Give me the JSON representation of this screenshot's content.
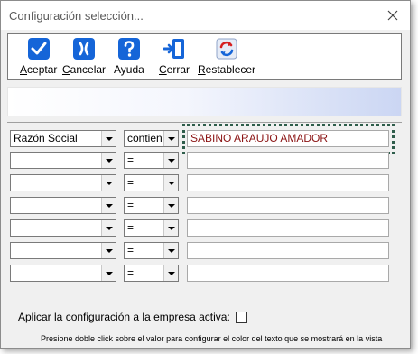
{
  "window": {
    "title": "Configuración selección..."
  },
  "toolbar": {
    "buttons": [
      {
        "label": "Aceptar",
        "mnemonic": "A",
        "rest": "ceptar",
        "icon": "checkmark-icon"
      },
      {
        "label": "Cancelar",
        "mnemonic": "C",
        "rest": "ancelar",
        "icon": "x-cancel-icon"
      },
      {
        "label": "Ayuda",
        "mnemonic": "",
        "rest": "Ayuda",
        "icon": "question-icon"
      },
      {
        "label": "Cerrar",
        "mnemonic": "C",
        "rest": "errar",
        "icon": "exit-door-icon"
      },
      {
        "label": "Restablecer",
        "mnemonic": "R",
        "rest": "establecer",
        "icon": "refresh-icon"
      }
    ]
  },
  "filters": [
    {
      "field": "Razón Social",
      "operator": "contiene",
      "value": "SABINO ARAUJO AMADOR"
    },
    {
      "field": "",
      "operator": "=",
      "value": ""
    },
    {
      "field": "",
      "operator": "=",
      "value": ""
    },
    {
      "field": "",
      "operator": "=",
      "value": ""
    },
    {
      "field": "",
      "operator": "=",
      "value": ""
    },
    {
      "field": "",
      "operator": "=",
      "value": ""
    },
    {
      "field": "",
      "operator": "=",
      "value": ""
    }
  ],
  "apply_label": "Aplicar la configuración a la empresa activa:",
  "apply_checked": false,
  "hint": "Presione doble click sobre el valor para configurar el color del texto que se mostrará en la vista",
  "colors": {
    "accent_blue": "#1565d8",
    "value_text": "#8b1414",
    "focus_ring": "#2e5d4b"
  }
}
